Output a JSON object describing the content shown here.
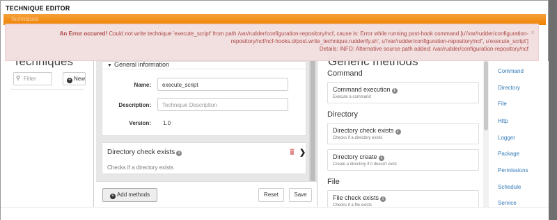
{
  "modal": {
    "title": "TECHNIQUE EDITOR",
    "bar_text": "Techniques"
  },
  "error": {
    "strong": "An Error occured!",
    "line1": " Could not write technique 'execute_script' from path /var/rudder/configuration-repository/ncf, cause is: Error while running post-hook command [u'/var/rudder/configuration-",
    "line2": "repository/ncf/ncf-hooks.d/post.write_technique.rudderify.sh', u'/var/rudder/configuration-repository/ncf', u'execute_script']",
    "line3": "Details: INFO: Alternative source path added: /var/rudder/configuration-repository/ncf",
    "close": "×"
  },
  "left": {
    "heading": "Techniques",
    "filter_placeholder": "Filter",
    "new_label": "New"
  },
  "general": {
    "header": "General information",
    "name_label": "Name:",
    "name_value": "execute_script",
    "description_label": "Description:",
    "description_placeholder": "Technique Description",
    "version_label": "Version:",
    "version_value": "1.0"
  },
  "method_card": {
    "title": "Directory check exists",
    "subtitle": "Checks if a directory exists"
  },
  "bottom": {
    "add_methods": "Add methods",
    "reset": "Reset",
    "save": "Save"
  },
  "right": {
    "heading": "Generic methods",
    "sections": [
      {
        "title": "Command",
        "items": [
          {
            "title": "Command execution",
            "subtitle": "Execute a command"
          }
        ]
      },
      {
        "title": "Directory",
        "items": [
          {
            "title": "Directory check exists",
            "subtitle": "Checks if a directory exists"
          },
          {
            "title": "Directory create",
            "subtitle": "Create a directory if it doesn't exist"
          }
        ]
      },
      {
        "title": "File",
        "items": [
          {
            "title": "File check exists",
            "subtitle": "Checks if a file exists"
          }
        ]
      }
    ],
    "categories": [
      "Command",
      "Directory",
      "File",
      "Http",
      "Logger",
      "Package",
      "Permissions",
      "Schedule",
      "Service"
    ]
  },
  "colors": {
    "accent": "#ee8200",
    "error_bg": "#f2dede",
    "error_text": "#a94442",
    "link": "#337ab7"
  },
  "icons": {
    "search": "search-icon",
    "plus": "plus-circle-icon",
    "info": "info-icon",
    "trash": "trash-icon",
    "chevron": "chevron-right-icon",
    "caret": "caret-down-icon"
  }
}
